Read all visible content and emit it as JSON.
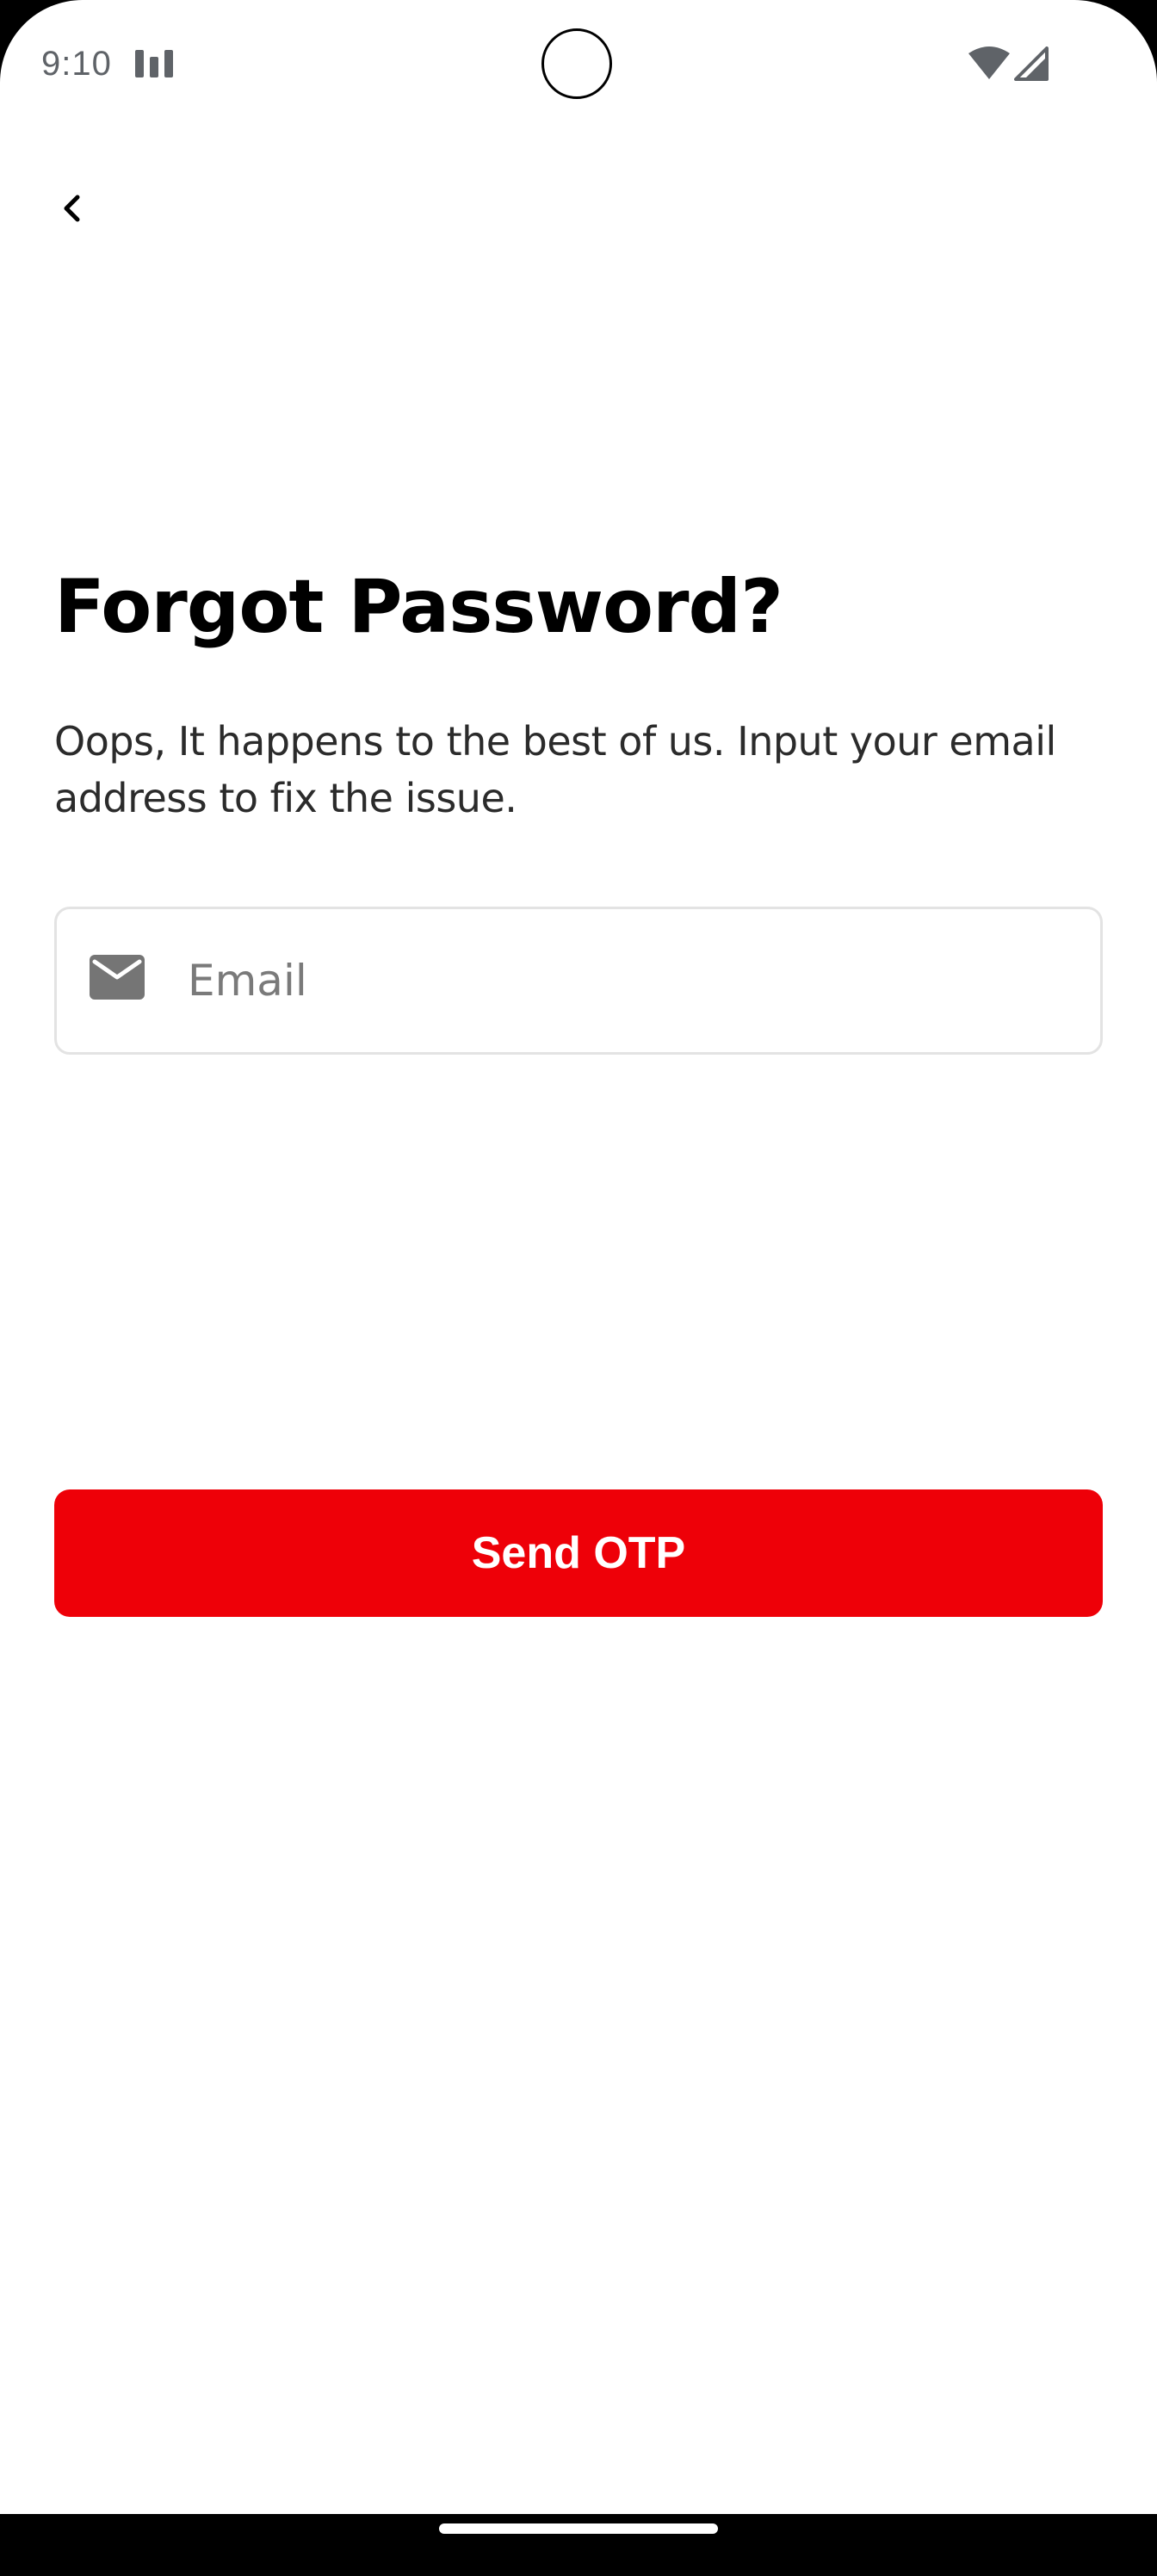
{
  "status_bar": {
    "time": "9:10",
    "icons": [
      "sim-card-icon",
      "wifi-icon",
      "cell-signal-icon"
    ]
  },
  "header": {
    "back_icon": "chevron-left-icon"
  },
  "main": {
    "title": "Forgot Password?",
    "subtitle": "Oops, It happens to the best of us. Input your email address to fix the issue.",
    "email": {
      "icon": "envelope-icon",
      "placeholder": "Email",
      "value": ""
    },
    "send_button_label": "Send OTP"
  },
  "colors": {
    "accent": "#ee0008",
    "background": "#ffffff",
    "text": "#000000",
    "field_border": "#e3e3e3",
    "placeholder": "#7a7a7a"
  }
}
